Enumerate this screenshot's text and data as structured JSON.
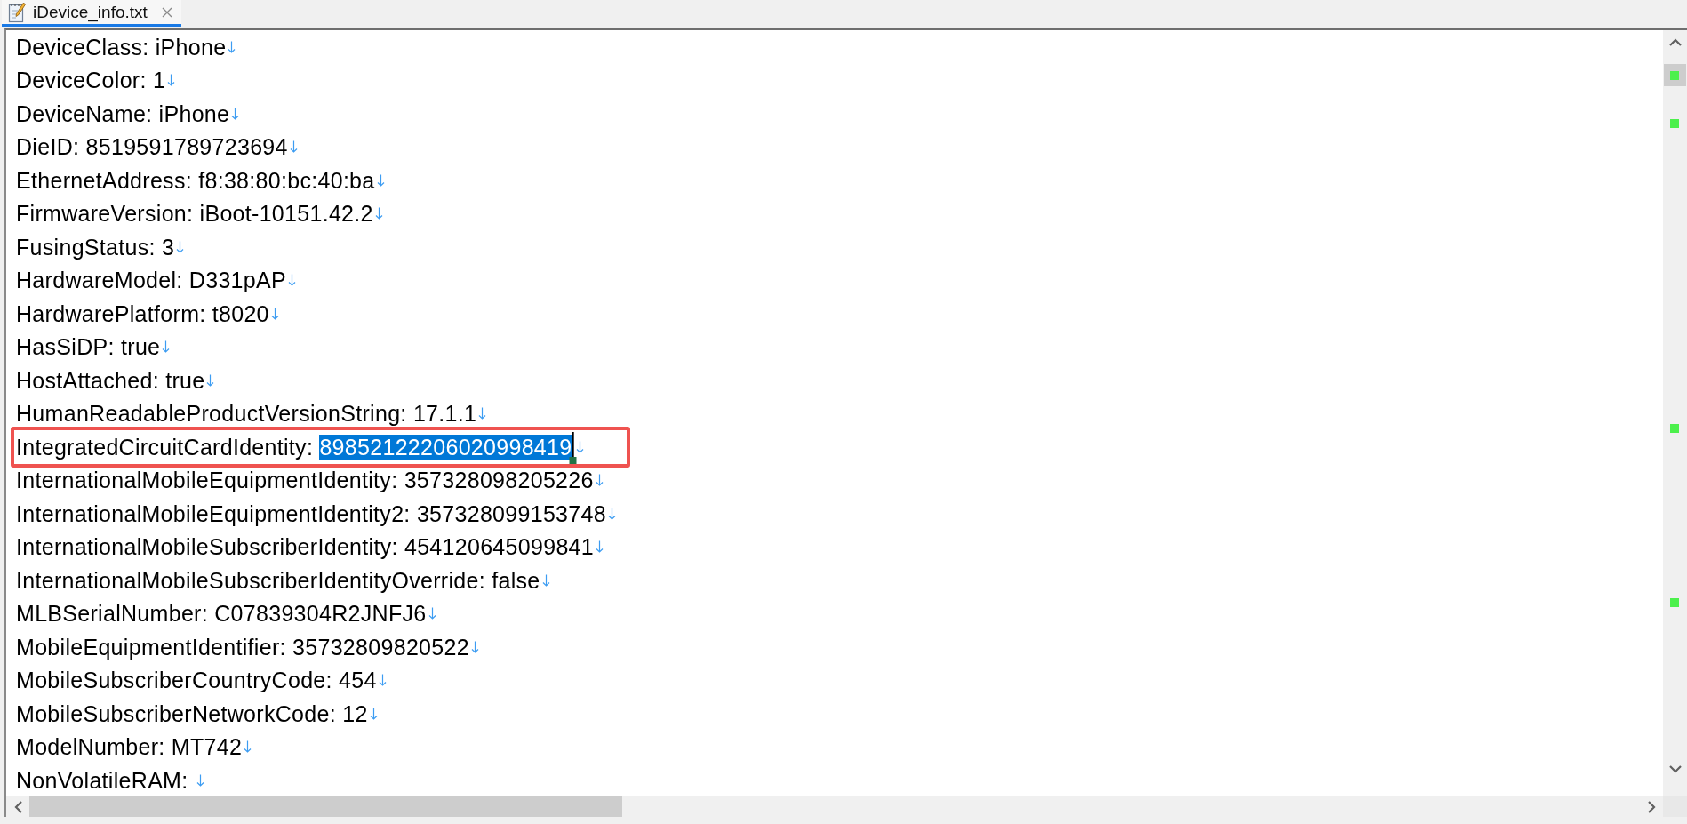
{
  "tabs": [
    {
      "title": "iDevice_info.txt",
      "selected": true
    }
  ],
  "editor": {
    "lines": [
      {
        "label": "DeviceClass:",
        "value": "iPhone",
        "selected": false,
        "boxed": false
      },
      {
        "label": "DeviceColor:",
        "value": "1",
        "selected": false,
        "boxed": false
      },
      {
        "label": "DeviceName:",
        "value": "iPhone",
        "selected": false,
        "boxed": false
      },
      {
        "label": "DieID:",
        "value": "8519591789723694",
        "selected": false,
        "boxed": false
      },
      {
        "label": "EthernetAddress:",
        "value": "f8:38:80:bc:40:ba",
        "selected": false,
        "boxed": false
      },
      {
        "label": "FirmwareVersion:",
        "value": "iBoot-10151.42.2",
        "selected": false,
        "boxed": false
      },
      {
        "label": "FusingStatus:",
        "value": "3",
        "selected": false,
        "boxed": false
      },
      {
        "label": "HardwareModel:",
        "value": "D331pAP",
        "selected": false,
        "boxed": false
      },
      {
        "label": "HardwarePlatform:",
        "value": "t8020",
        "selected": false,
        "boxed": false
      },
      {
        "label": "HasSiDP:",
        "value": "true",
        "selected": false,
        "boxed": false
      },
      {
        "label": "HostAttached:",
        "value": "true",
        "selected": false,
        "boxed": false
      },
      {
        "label": "HumanReadableProductVersionString:",
        "value": "17.1.1",
        "selected": false,
        "boxed": false
      },
      {
        "label": "IntegratedCircuitCardIdentity:",
        "value": "89852122206020998419",
        "selected": true,
        "boxed": true
      },
      {
        "label": "InternationalMobileEquipmentIdentity:",
        "value": "357328098205226",
        "selected": false,
        "boxed": false
      },
      {
        "label": "InternationalMobileEquipmentIdentity2:",
        "value": "357328099153748",
        "selected": false,
        "boxed": false
      },
      {
        "label": "InternationalMobileSubscriberIdentity:",
        "value": "454120645099841",
        "selected": false,
        "boxed": false
      },
      {
        "label": "InternationalMobileSubscriberIdentityOverride:",
        "value": "false",
        "selected": false,
        "boxed": false
      },
      {
        "label": "MLBSerialNumber:",
        "value": "C07839304R2JNFJ6",
        "selected": false,
        "boxed": false
      },
      {
        "label": "MobileEquipmentIdentifier:",
        "value": "35732809820522",
        "selected": false,
        "boxed": false
      },
      {
        "label": "MobileSubscriberCountryCode:",
        "value": "454",
        "selected": false,
        "boxed": false
      },
      {
        "label": "MobileSubscriberNetworkCode:",
        "value": "12",
        "selected": false,
        "boxed": false
      },
      {
        "label": "ModelNumber:",
        "value": "MT742",
        "selected": false,
        "boxed": false
      },
      {
        "label": "NonVolatileRAM:",
        "selected": false,
        "boxed": false
      }
    ]
  }
}
